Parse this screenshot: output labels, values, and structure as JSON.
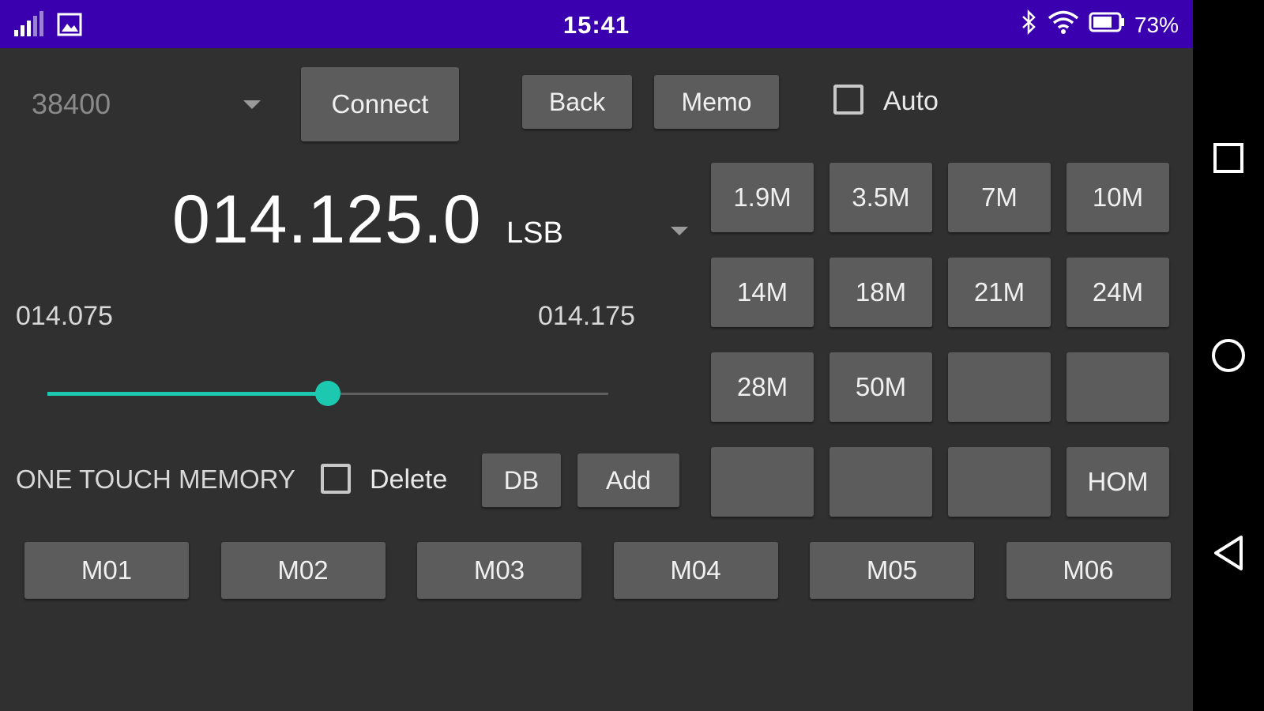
{
  "status_bar": {
    "time": "15:41",
    "battery": "73%",
    "icons": [
      "signal-icon",
      "image-icon",
      "bluetooth-icon",
      "wifi-icon",
      "battery-icon"
    ]
  },
  "toolbar": {
    "baud_rate": "38400",
    "connect_label": "Connect",
    "back_label": "Back",
    "memo_label": "Memo",
    "auto_label": "Auto",
    "auto_checked": false
  },
  "frequency": {
    "value": "014.125.0",
    "mode": "LSB",
    "range_min": "014.075",
    "range_max": "014.175",
    "slider_fraction": 0.5
  },
  "bands": [
    "1.9M",
    "3.5M",
    "7M",
    "10M",
    "14M",
    "18M",
    "21M",
    "24M",
    "28M",
    "50M",
    "",
    "",
    "",
    "",
    "",
    "HOM"
  ],
  "memory_section": {
    "title": "ONE TOUCH MEMORY",
    "delete_label": "Delete",
    "delete_checked": false,
    "db_label": "DB",
    "add_label": "Add"
  },
  "memories": [
    "M01",
    "M02",
    "M03",
    "M04",
    "M05",
    "M06"
  ],
  "colors": {
    "status_bar": "#3a00b0",
    "background": "#303030",
    "button": "#5c5c5c",
    "accent": "#1dc8b0"
  },
  "nav": [
    "recents-icon",
    "home-icon",
    "back-icon"
  ]
}
